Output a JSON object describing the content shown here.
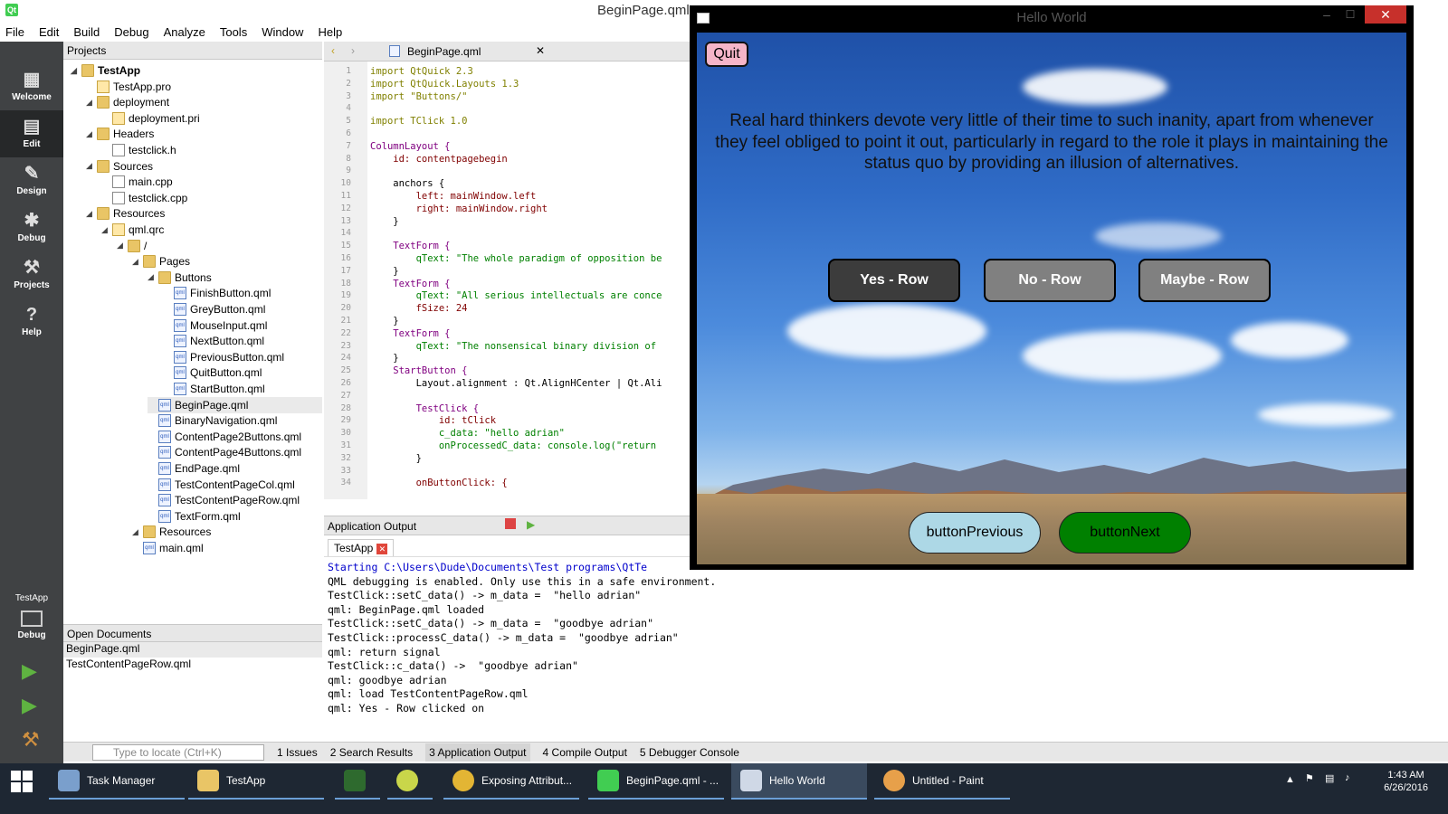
{
  "qt": {
    "window_title": "BeginPage.qml",
    "menu": [
      "File",
      "Edit",
      "Build",
      "Debug",
      "Analyze",
      "Tools",
      "Window",
      "Help"
    ],
    "modes": [
      "Welcome",
      "Edit",
      "Design",
      "Debug",
      "Projects",
      "Help"
    ],
    "kit": {
      "project": "TestApp",
      "mode": "Debug"
    },
    "projects_label": "Projects",
    "tree": [
      {
        "label": "TestApp",
        "depth": 0,
        "icon": "folder",
        "bold": true
      },
      {
        "label": "TestApp.pro",
        "depth": 1,
        "icon": "pro"
      },
      {
        "label": "deployment",
        "depth": 1,
        "icon": "folder"
      },
      {
        "label": "deployment.pri",
        "depth": 2,
        "icon": "pro"
      },
      {
        "label": "Headers",
        "depth": 1,
        "icon": "folder"
      },
      {
        "label": "testclick.h",
        "depth": 2,
        "icon": "file"
      },
      {
        "label": "Sources",
        "depth": 1,
        "icon": "folder"
      },
      {
        "label": "main.cpp",
        "depth": 2,
        "icon": "file"
      },
      {
        "label": "testclick.cpp",
        "depth": 2,
        "icon": "file"
      },
      {
        "label": "Resources",
        "depth": 1,
        "icon": "folder"
      },
      {
        "label": "qml.qrc",
        "depth": 2,
        "icon": "pro"
      },
      {
        "label": "/",
        "depth": 3,
        "icon": "folder"
      },
      {
        "label": "Pages",
        "depth": 4,
        "icon": "folder"
      },
      {
        "label": "Buttons",
        "depth": 5,
        "icon": "folder"
      },
      {
        "label": "FinishButton.qml",
        "depth": 6,
        "icon": "qml"
      },
      {
        "label": "GreyButton.qml",
        "depth": 6,
        "icon": "qml"
      },
      {
        "label": "MouseInput.qml",
        "depth": 6,
        "icon": "qml"
      },
      {
        "label": "NextButton.qml",
        "depth": 6,
        "icon": "qml"
      },
      {
        "label": "PreviousButton.qml",
        "depth": 6,
        "icon": "qml"
      },
      {
        "label": "QuitButton.qml",
        "depth": 6,
        "icon": "qml"
      },
      {
        "label": "StartButton.qml",
        "depth": 6,
        "icon": "qml"
      },
      {
        "label": "BeginPage.qml",
        "depth": 5,
        "icon": "qml",
        "selected": true
      },
      {
        "label": "BinaryNavigation.qml",
        "depth": 5,
        "icon": "qml"
      },
      {
        "label": "ContentPage2Buttons.qml",
        "depth": 5,
        "icon": "qml"
      },
      {
        "label": "ContentPage4Buttons.qml",
        "depth": 5,
        "icon": "qml"
      },
      {
        "label": "EndPage.qml",
        "depth": 5,
        "icon": "qml"
      },
      {
        "label": "TestContentPageCol.qml",
        "depth": 5,
        "icon": "qml"
      },
      {
        "label": "TestContentPageRow.qml",
        "depth": 5,
        "icon": "qml"
      },
      {
        "label": "TextForm.qml",
        "depth": 5,
        "icon": "qml"
      },
      {
        "label": "Resources",
        "depth": 4,
        "icon": "folder"
      },
      {
        "label": "main.qml",
        "depth": 4,
        "icon": "qml"
      }
    ],
    "open_documents_label": "Open Documents",
    "open_documents": [
      "BeginPage.qml",
      "TestContentPageRow.qml"
    ],
    "editor_tab": "BeginPage.qml",
    "code": [
      {
        "n": "1",
        "t": "import QtQuick 2.3"
      },
      {
        "n": "2",
        "t": "import QtQuick.Layouts 1.3"
      },
      {
        "n": "3",
        "t": "import \"Buttons/\""
      },
      {
        "n": "4",
        "t": ""
      },
      {
        "n": "5",
        "t": "import TClick 1.0"
      },
      {
        "n": "6",
        "t": ""
      },
      {
        "n": "7",
        "t": "ColumnLayout {"
      },
      {
        "n": "8",
        "t": "    id: contentpagebegin"
      },
      {
        "n": "9",
        "t": ""
      },
      {
        "n": "10",
        "t": "    anchors {"
      },
      {
        "n": "11",
        "t": "        left: mainWindow.left"
      },
      {
        "n": "12",
        "t": "        right: mainWindow.right"
      },
      {
        "n": "13",
        "t": "    }"
      },
      {
        "n": "14",
        "t": ""
      },
      {
        "n": "15",
        "t": "    TextForm {"
      },
      {
        "n": "16",
        "t": "        qText: \"The whole paradigm of opposition be"
      },
      {
        "n": "17",
        "t": "    }"
      },
      {
        "n": "18",
        "t": "    TextForm {"
      },
      {
        "n": "19",
        "t": "        qText: \"All serious intellectuals are conce"
      },
      {
        "n": "20",
        "t": "        fSize: 24"
      },
      {
        "n": "21",
        "t": "    }"
      },
      {
        "n": "22",
        "t": "    TextForm {"
      },
      {
        "n": "23",
        "t": "        qText: \"The nonsensical binary division of"
      },
      {
        "n": "24",
        "t": "    }"
      },
      {
        "n": "25",
        "t": "    StartButton {"
      },
      {
        "n": "26",
        "t": "        Layout.alignment : Qt.AlignHCenter | Qt.Ali"
      },
      {
        "n": "27",
        "t": ""
      },
      {
        "n": "28",
        "t": "        TestClick {"
      },
      {
        "n": "29",
        "t": "            id: tClick"
      },
      {
        "n": "30",
        "t": "            c_data: \"hello adrian\""
      },
      {
        "n": "31",
        "t": "            onProcessedC_data: console.log(\"return"
      },
      {
        "n": "32",
        "t": "        }"
      },
      {
        "n": "33",
        "t": ""
      },
      {
        "n": "34",
        "t": "        onButtonClick: {"
      }
    ],
    "output_panel_label": "Application Output",
    "output_tab": "TestApp",
    "output_lines": [
      "Starting C:\\Users\\Dude\\Documents\\Test programs\\QtTe",
      "QML debugging is enabled. Only use this in a safe environment.",
      "TestClick::setC_data() -> m_data =  \"hello adrian\"",
      "qml: BeginPage.qml loaded",
      "TestClick::setC_data() -> m_data =  \"goodbye adrian\"",
      "TestClick::processC_data() -> m_data =  \"goodbye adrian\"",
      "qml: return signal",
      "TestClick::c_data() ->  \"goodbye adrian\"",
      "qml: goodbye adrian",
      "qml: load TestContentPageRow.qml",
      "qml: Yes - Row clicked on"
    ],
    "locator_placeholder": "Type to locate (Ctrl+K)",
    "bottom_tabs": [
      "1  Issues",
      "2  Search Results",
      "3  Application Output",
      "4  Compile Output",
      "5  Debugger Console"
    ]
  },
  "hello": {
    "title": "Hello World",
    "quit": "Quit",
    "quote": "Real hard thinkers devote very little of their time to such inanity, apart from whenever they feel obliged to point it out, particularly in regard to the role it plays in maintaining the status quo by providing an illusion of alternatives.",
    "buttons": [
      "Yes - Row",
      "No - Row",
      "Maybe - Row"
    ],
    "prev": "buttonPrevious",
    "next": "buttonNext",
    "colors": {
      "yes": "#3c3c3c",
      "no": "#808080",
      "maybe": "#808080",
      "prev": "#add8e6",
      "next": "#008000",
      "quit": "#f5b5c8"
    }
  },
  "taskbar": {
    "items": [
      "Task Manager",
      "TestApp",
      "",
      "",
      "Exposing Attribut...",
      "BeginPage.qml - ...",
      "Hello World",
      "Untitled - Paint"
    ],
    "time": "1:43 AM",
    "date": "6/26/2016"
  }
}
